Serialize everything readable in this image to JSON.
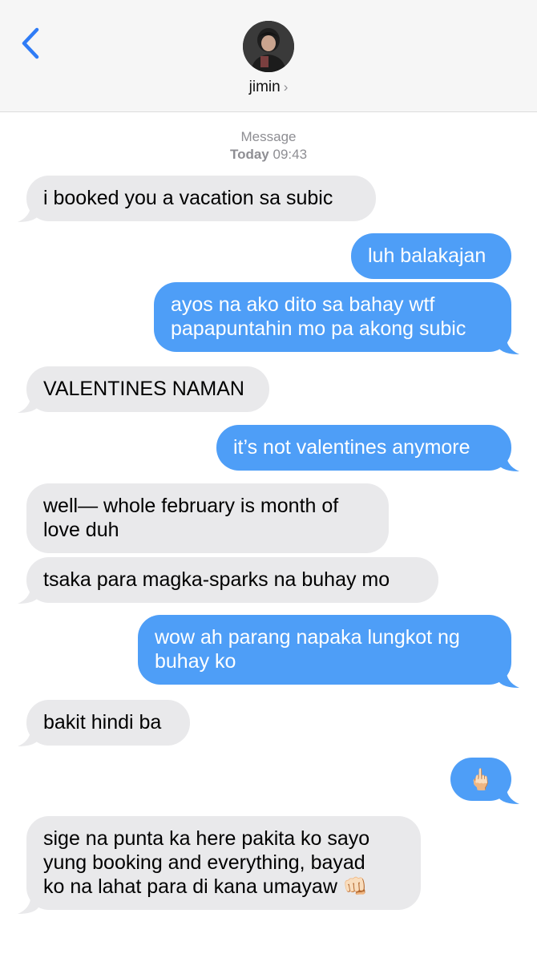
{
  "header": {
    "contact_name": "jimin",
    "chevron": "›"
  },
  "meta": {
    "label": "Message",
    "day": "Today",
    "time": "09:43"
  },
  "messages": [
    {
      "from": "them",
      "text": "i booked you a vacation sa subic"
    },
    {
      "from": "me",
      "text": "luh balakajan"
    },
    {
      "from": "me",
      "lines": [
        "ayos na ako dito sa bahay wtf",
        "papapuntahin mo pa akong subic"
      ]
    },
    {
      "from": "them",
      "text": "VALENTINES NAMAN"
    },
    {
      "from": "me",
      "text": "it’s not valentines anymore"
    },
    {
      "from": "them",
      "lines": [
        "well— whole february is month of",
        "love duh"
      ]
    },
    {
      "from": "them",
      "text": "tsaka para magka-sparks na buhay mo"
    },
    {
      "from": "me",
      "lines": [
        "wow ah parang napaka lungkot ng",
        "buhay ko"
      ]
    },
    {
      "from": "them",
      "text": "bakit hindi ba"
    },
    {
      "from": "me",
      "text": "🖕🏻"
    },
    {
      "from": "them",
      "lines": [
        "sige na punta ka here pakita ko sayo",
        "yung booking and everything, bayad",
        "ko na lahat para di kana umayaw"
      ],
      "trailing_emoji": "👊🏻"
    }
  ],
  "colors": {
    "incoming": "#e9e9eb",
    "outgoing": "#4e9ef7",
    "accent": "#2f7cf6"
  },
  "icons": {
    "back": "chevron-left-icon",
    "contact": "chevron-right-icon"
  }
}
